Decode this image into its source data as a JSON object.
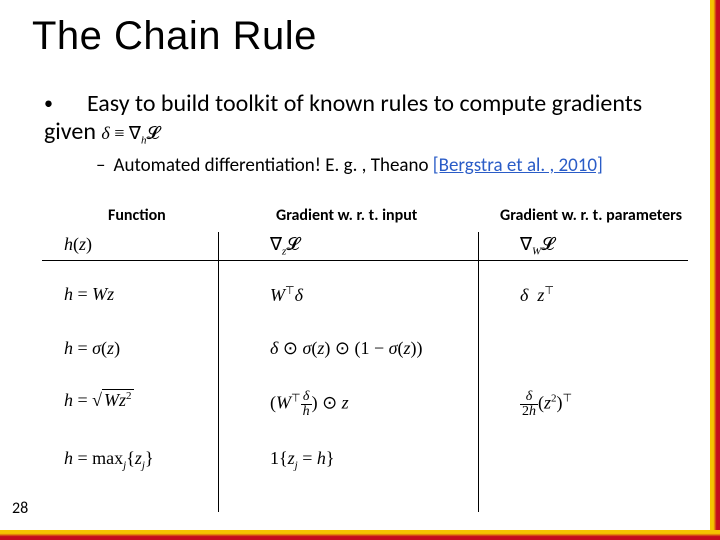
{
  "title": "The Chain Rule",
  "bullets": {
    "l1_pre": "Easy to build toolkit of known rules to compute gradients given ",
    "l1_formula": "δ ≡ ∇h 𝓛",
    "l2_pre": "Automated differentiation!  E. g. , Theano ",
    "l2_link": "[Bergstra et al. , 2010]"
  },
  "headers": {
    "h1": "Function",
    "h2": "Gradient w. r. t. input",
    "h3": "Gradient w. r. t. parameters"
  },
  "row_hdr": {
    "c1": "h(z)",
    "c2": "∇z 𝓛",
    "c3": "∇W 𝓛"
  },
  "rows": [
    {
      "f": "h = Wz",
      "gi": "W⊤δ",
      "gp": "δ  z⊤"
    },
    {
      "f": "h = σ(z)",
      "gi": "δ ⊙ σ(z) ⊙ (1 − σ(z))",
      "gp": ""
    },
    {
      "f_pre": "h = ",
      "f_rad": "Wz",
      "f_sup": "2",
      "gi_pre": "(W⊤",
      "gi_frac_num": "δ",
      "gi_frac_den": "h",
      "gi_post": ") ⊙ z",
      "gp_frac_num": "δ",
      "gp_frac_den": "2h",
      "gp_post1": "(z",
      "gp_sup": "2",
      "gp_post2": ")⊤"
    },
    {
      "f": "h = maxj{zj}",
      "gi": "1{zj = h}",
      "gp": ""
    }
  ],
  "page": "28",
  "chart_data": {
    "type": "table",
    "title": "Chain-rule gradients for common layer functions (given δ ≡ ∇h L)",
    "columns": [
      "Function h(z)",
      "Gradient w.r.t. input  ∇z L",
      "Gradient w.r.t. parameters  ∇W L"
    ],
    "rows": [
      [
        "h = Wz",
        "Wᵀ δ",
        "δ zᵀ"
      ],
      [
        "h = σ(z)",
        "δ ⊙ σ(z) ⊙ (1 − σ(z))",
        ""
      ],
      [
        "h = √(W z²)",
        "(Wᵀ (δ / h)) ⊙ z",
        "(δ / 2h) (z²)ᵀ"
      ],
      [
        "h = maxⱼ {zⱼ}",
        "1{zⱼ = h}",
        ""
      ]
    ]
  }
}
